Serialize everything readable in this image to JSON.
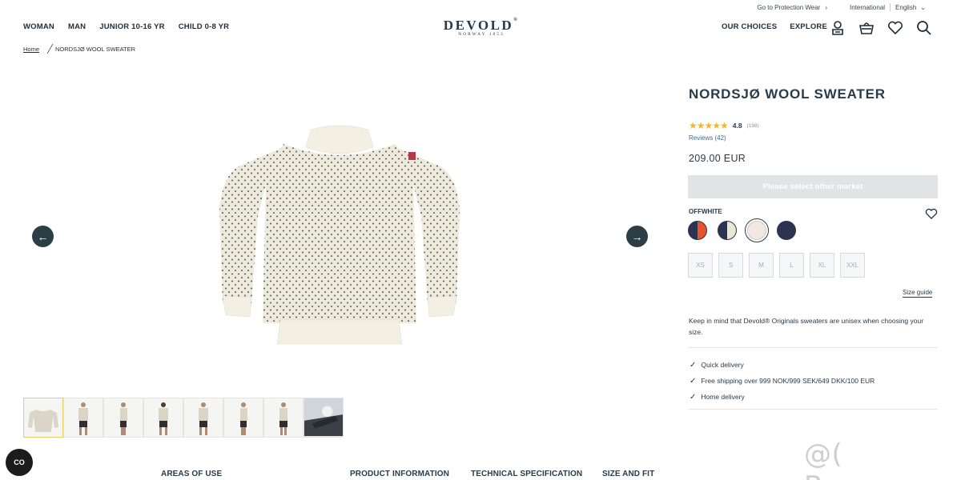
{
  "utility": {
    "protection_link": "Go to Protection Wear",
    "region": "International",
    "language": "English"
  },
  "nav": {
    "left": [
      "WOMAN",
      "MAN",
      "JUNIOR 10-16 YR",
      "CHILD 0-8 YR"
    ],
    "right": [
      "OUR CHOICES",
      "EXPLORE"
    ]
  },
  "logo": {
    "brand": "DEVOLD",
    "tagline": "NORWAY 1853"
  },
  "icons": [
    "account-icon",
    "basket-icon",
    "wishlist-heart-icon",
    "search-icon"
  ],
  "breadcrumb": {
    "home": "Home",
    "current": "NORDSJØ WOOL SWEATER"
  },
  "product": {
    "title": "NORDSJØ WOOL SWEATER",
    "rating": "4.8",
    "rating_value": 4.8,
    "rating_count": "(198)",
    "reviews_link": "Reviews (42)",
    "price": "209.00 EUR",
    "cta": "Please select other market",
    "color_name": "OFFWHITE",
    "swatches": [
      {
        "name": "orange-navy",
        "colors": [
          "#e5542b",
          "#2c3350"
        ]
      },
      {
        "name": "offwhite-navy",
        "colors": [
          "#eae5d6",
          "#2c3350"
        ]
      },
      {
        "name": "offwhite",
        "colors": [
          "#f1e8e4",
          "#f1e8e4"
        ],
        "selected": true
      },
      {
        "name": "navy",
        "colors": [
          "#2c3350",
          "#2c3350"
        ]
      }
    ],
    "sizes": [
      "XS",
      "S",
      "M",
      "L",
      "XL",
      "XXL"
    ],
    "size_guide": "Size guide",
    "unisex_note": "Keep in mind that Devold® Originals sweaters are unisex when choosing your size.",
    "features": [
      "Quick delivery",
      "Free shipping over 999 NOK/999 SEK/649 DKK/100 EUR",
      "Home delivery"
    ]
  },
  "gallery": {
    "thumbnail_count": 8
  },
  "tabs": [
    "AREAS OF USE",
    "PRODUCT INFORMATION",
    "TECHNICAL SPECIFICATION",
    "SIZE AND FIT"
  ],
  "widget": {
    "label": "CO"
  },
  "watermark": "@( Bazos.cz"
}
